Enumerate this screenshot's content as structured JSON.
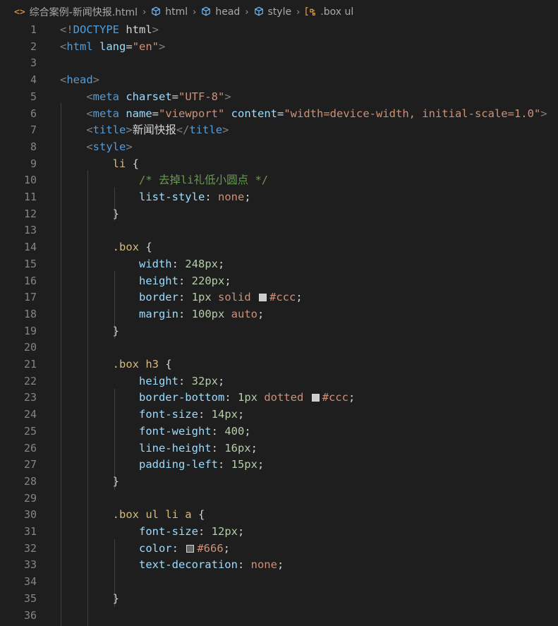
{
  "breadcrumb": {
    "items": [
      {
        "label": "综合案例-新闻快报.html",
        "icon": "html-file-icon"
      },
      {
        "label": "html",
        "icon": "element-tag-icon"
      },
      {
        "label": "head",
        "icon": "element-tag-icon"
      },
      {
        "label": "style",
        "icon": "element-tag-icon"
      },
      {
        "label": ".box ul",
        "icon": "css-selector-symbol-icon"
      }
    ],
    "separator": "›"
  },
  "editor": {
    "lines": [
      {
        "n": "1",
        "t": [
          [
            "p",
            "<!"
          ],
          [
            "g",
            "DOCTYPE"
          ],
          [
            "x",
            " html"
          ],
          [
            "p",
            ">"
          ]
        ]
      },
      {
        "n": "2",
        "t": [
          [
            "p",
            "<"
          ],
          [
            "g",
            "html"
          ],
          [
            "a",
            " lang"
          ],
          [
            "x",
            "="
          ],
          [
            "s",
            "\"en\""
          ],
          [
            "p",
            ">"
          ]
        ]
      },
      {
        "n": "3",
        "t": []
      },
      {
        "n": "4",
        "t": [
          [
            "p",
            "<"
          ],
          [
            "g",
            "head"
          ],
          [
            "p",
            ">"
          ]
        ]
      },
      {
        "n": "5",
        "t": [
          [
            "x",
            "    "
          ],
          [
            "p",
            "<"
          ],
          [
            "g",
            "meta"
          ],
          [
            "a",
            " charset"
          ],
          [
            "x",
            "="
          ],
          [
            "s",
            "\"UTF-8\""
          ],
          [
            "p",
            ">"
          ]
        ]
      },
      {
        "n": "6",
        "t": [
          [
            "x",
            "    "
          ],
          [
            "p",
            "<"
          ],
          [
            "g",
            "meta"
          ],
          [
            "a",
            " name"
          ],
          [
            "x",
            "="
          ],
          [
            "s",
            "\"viewport\""
          ],
          [
            "a",
            " content"
          ],
          [
            "x",
            "="
          ],
          [
            "s",
            "\"width=device-width, initial-scale=1.0\""
          ],
          [
            "p",
            ">"
          ]
        ]
      },
      {
        "n": "7",
        "t": [
          [
            "x",
            "    "
          ],
          [
            "p",
            "<"
          ],
          [
            "g",
            "title"
          ],
          [
            "p",
            ">"
          ],
          [
            "x",
            "新闻快报"
          ],
          [
            "p",
            "</"
          ],
          [
            "g",
            "title"
          ],
          [
            "p",
            ">"
          ]
        ]
      },
      {
        "n": "8",
        "t": [
          [
            "x",
            "    "
          ],
          [
            "p",
            "<"
          ],
          [
            "g",
            "style"
          ],
          [
            "p",
            ">"
          ]
        ]
      },
      {
        "n": "9",
        "t": [
          [
            "x",
            "        "
          ],
          [
            "e",
            "li"
          ],
          [
            "x",
            " {"
          ]
        ]
      },
      {
        "n": "10",
        "t": [
          [
            "x",
            "            "
          ],
          [
            "c",
            "/* 去掉li礼低小圆点 */"
          ]
        ]
      },
      {
        "n": "11",
        "t": [
          [
            "x",
            "            "
          ],
          [
            "r",
            "list-style"
          ],
          [
            "x",
            ": "
          ],
          [
            "v",
            "none"
          ],
          [
            "x",
            ";"
          ]
        ]
      },
      {
        "n": "12",
        "t": [
          [
            "x",
            "        }"
          ]
        ]
      },
      {
        "n": "13",
        "t": []
      },
      {
        "n": "14",
        "t": [
          [
            "x",
            "        "
          ],
          [
            "e",
            ".box"
          ],
          [
            "x",
            " {"
          ]
        ]
      },
      {
        "n": "15",
        "t": [
          [
            "x",
            "            "
          ],
          [
            "r",
            "width"
          ],
          [
            "x",
            ": "
          ],
          [
            "m",
            "248px"
          ],
          [
            "x",
            ";"
          ]
        ]
      },
      {
        "n": "16",
        "t": [
          [
            "x",
            "            "
          ],
          [
            "r",
            "height"
          ],
          [
            "x",
            ": "
          ],
          [
            "m",
            "220px"
          ],
          [
            "x",
            ";"
          ]
        ]
      },
      {
        "n": "17",
        "t": [
          [
            "x",
            "            "
          ],
          [
            "r",
            "border"
          ],
          [
            "x",
            ": "
          ],
          [
            "m",
            "1px"
          ],
          [
            "v",
            " solid "
          ],
          [
            "w",
            "#cccccc"
          ],
          [
            "v",
            "#ccc"
          ],
          [
            "x",
            ";"
          ]
        ]
      },
      {
        "n": "18",
        "t": [
          [
            "x",
            "            "
          ],
          [
            "r",
            "margin"
          ],
          [
            "x",
            ": "
          ],
          [
            "m",
            "100px"
          ],
          [
            "v",
            " auto"
          ],
          [
            "x",
            ";"
          ]
        ]
      },
      {
        "n": "19",
        "t": [
          [
            "x",
            "        }"
          ]
        ]
      },
      {
        "n": "20",
        "t": []
      },
      {
        "n": "21",
        "t": [
          [
            "x",
            "        "
          ],
          [
            "e",
            ".box h3"
          ],
          [
            "x",
            " {"
          ]
        ]
      },
      {
        "n": "22",
        "t": [
          [
            "x",
            "            "
          ],
          [
            "r",
            "height"
          ],
          [
            "x",
            ": "
          ],
          [
            "m",
            "32px"
          ],
          [
            "x",
            ";"
          ]
        ]
      },
      {
        "n": "23",
        "t": [
          [
            "x",
            "            "
          ],
          [
            "r",
            "border-bottom"
          ],
          [
            "x",
            ": "
          ],
          [
            "m",
            "1px"
          ],
          [
            "v",
            " dotted "
          ],
          [
            "w",
            "#cccccc"
          ],
          [
            "v",
            "#ccc"
          ],
          [
            "x",
            ";"
          ]
        ]
      },
      {
        "n": "24",
        "t": [
          [
            "x",
            "            "
          ],
          [
            "r",
            "font-size"
          ],
          [
            "x",
            ": "
          ],
          [
            "m",
            "14px"
          ],
          [
            "x",
            ";"
          ]
        ]
      },
      {
        "n": "25",
        "t": [
          [
            "x",
            "            "
          ],
          [
            "r",
            "font-weight"
          ],
          [
            "x",
            ": "
          ],
          [
            "m",
            "400"
          ],
          [
            "x",
            ";"
          ]
        ]
      },
      {
        "n": "26",
        "t": [
          [
            "x",
            "            "
          ],
          [
            "r",
            "line-height"
          ],
          [
            "x",
            ": "
          ],
          [
            "m",
            "16px"
          ],
          [
            "x",
            ";"
          ]
        ]
      },
      {
        "n": "27",
        "t": [
          [
            "x",
            "            "
          ],
          [
            "r",
            "padding-left"
          ],
          [
            "x",
            ": "
          ],
          [
            "m",
            "15px"
          ],
          [
            "x",
            ";"
          ]
        ]
      },
      {
        "n": "28",
        "t": [
          [
            "x",
            "        }"
          ]
        ]
      },
      {
        "n": "29",
        "t": []
      },
      {
        "n": "30",
        "t": [
          [
            "x",
            "        "
          ],
          [
            "e",
            ".box ul li a"
          ],
          [
            "x",
            " {"
          ]
        ]
      },
      {
        "n": "31",
        "t": [
          [
            "x",
            "            "
          ],
          [
            "r",
            "font-size"
          ],
          [
            "x",
            ": "
          ],
          [
            "m",
            "12px"
          ],
          [
            "x",
            ";"
          ]
        ]
      },
      {
        "n": "32",
        "t": [
          [
            "x",
            "            "
          ],
          [
            "r",
            "color"
          ],
          [
            "x",
            ": "
          ],
          [
            "w",
            "#666666"
          ],
          [
            "v",
            "#666"
          ],
          [
            "x",
            ";"
          ]
        ]
      },
      {
        "n": "33",
        "t": [
          [
            "x",
            "            "
          ],
          [
            "r",
            "text-decoration"
          ],
          [
            "x",
            ": "
          ],
          [
            "v",
            "none"
          ],
          [
            "x",
            ";"
          ]
        ]
      },
      {
        "n": "34",
        "t": []
      },
      {
        "n": "35",
        "t": [
          [
            "x",
            "        }"
          ]
        ]
      },
      {
        "n": "36",
        "t": []
      }
    ]
  },
  "colors": {
    "background": "#1e1e1e",
    "line_number": "#858585",
    "tag": "#569cd6",
    "attribute": "#9cdcfe",
    "string": "#ce9178",
    "selector": "#d7ba7d",
    "number": "#b5cea8",
    "comment": "#6a9955",
    "punctuation": "#808080"
  }
}
